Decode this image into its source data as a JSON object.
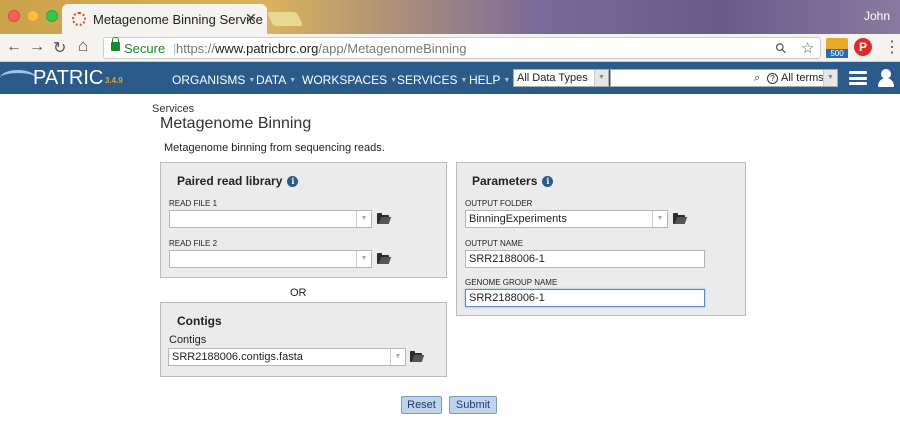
{
  "browser": {
    "tab_title": "Metagenome Binning Service",
    "tab_close": "✕",
    "user_name": "John",
    "secure_label": "Secure",
    "url_prefix": "https://",
    "url_domain": "www.patricbrc.org",
    "url_path": "/app/MetagenomeBinning",
    "ext_badge": "500",
    "pinterest_glyph": "P"
  },
  "header": {
    "logo": "PATRIC",
    "version": "3.4.9",
    "menu": [
      "ORGANISMS",
      "DATA",
      "WORKSPACES",
      "SERVICES",
      "HELP"
    ],
    "data_type": "All Data Types",
    "search_value": "",
    "search_scope": "All terms",
    "brand_color": "#2b5b8b"
  },
  "page": {
    "breadcrumb": "Services",
    "title": "Metagenome Binning",
    "description": "Metagenome binning from sequencing reads."
  },
  "paired_panel": {
    "title": "Paired read library",
    "read1_label": "READ FILE 1",
    "read1_value": "",
    "read2_label": "READ FILE 2",
    "read2_value": ""
  },
  "or_label": "OR",
  "contigs_panel": {
    "title": "Contigs",
    "field_label": "Contigs",
    "value": "SRR2188006.contigs.fasta"
  },
  "params_panel": {
    "title": "Parameters",
    "output_folder_label": "OUTPUT FOLDER",
    "output_folder_value": "BinningExperiments",
    "output_name_label": "OUTPUT NAME",
    "output_name_value": "SRR2188006-1",
    "genome_group_label": "GENOME GROUP NAME",
    "genome_group_value": "SRR2188006-1"
  },
  "buttons": {
    "reset": "Reset",
    "submit": "Submit"
  },
  "icons": {
    "info": "i",
    "dropdown": "▼",
    "back": "←",
    "forward": "→",
    "reload": "↻",
    "home": "⌂",
    "zoom": "⚲",
    "star": "☆",
    "menu_dots": "⋮",
    "search": "🔍︎",
    "help": "?"
  }
}
